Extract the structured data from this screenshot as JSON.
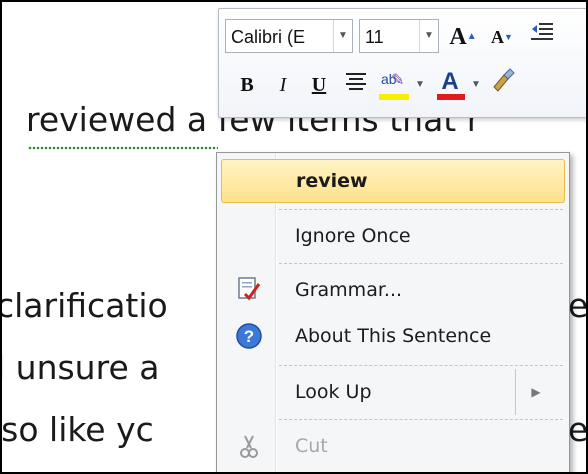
{
  "document": {
    "lines": [
      "reviewed a few items that r",
      "clarificatio",
      "l unsure a",
      "lso like yc"
    ],
    "right_fragments": [
      "e",
      "e"
    ]
  },
  "mini_toolbar": {
    "font_name": "Calibri (E",
    "font_size": "11",
    "grow_font": "A",
    "shrink_font": "A",
    "bold": "B",
    "italic": "I",
    "underline": "U",
    "highlight_glyph": "ab",
    "font_color_glyph": "A",
    "colors": {
      "highlight": "#f6f000",
      "font_color": "#e01b1b"
    }
  },
  "context_menu": {
    "suggestion": "review",
    "ignore_once": "Ignore Once",
    "grammar": "Grammar...",
    "about_sentence": "About This Sentence",
    "look_up": "Look Up",
    "cut": "Cut"
  }
}
